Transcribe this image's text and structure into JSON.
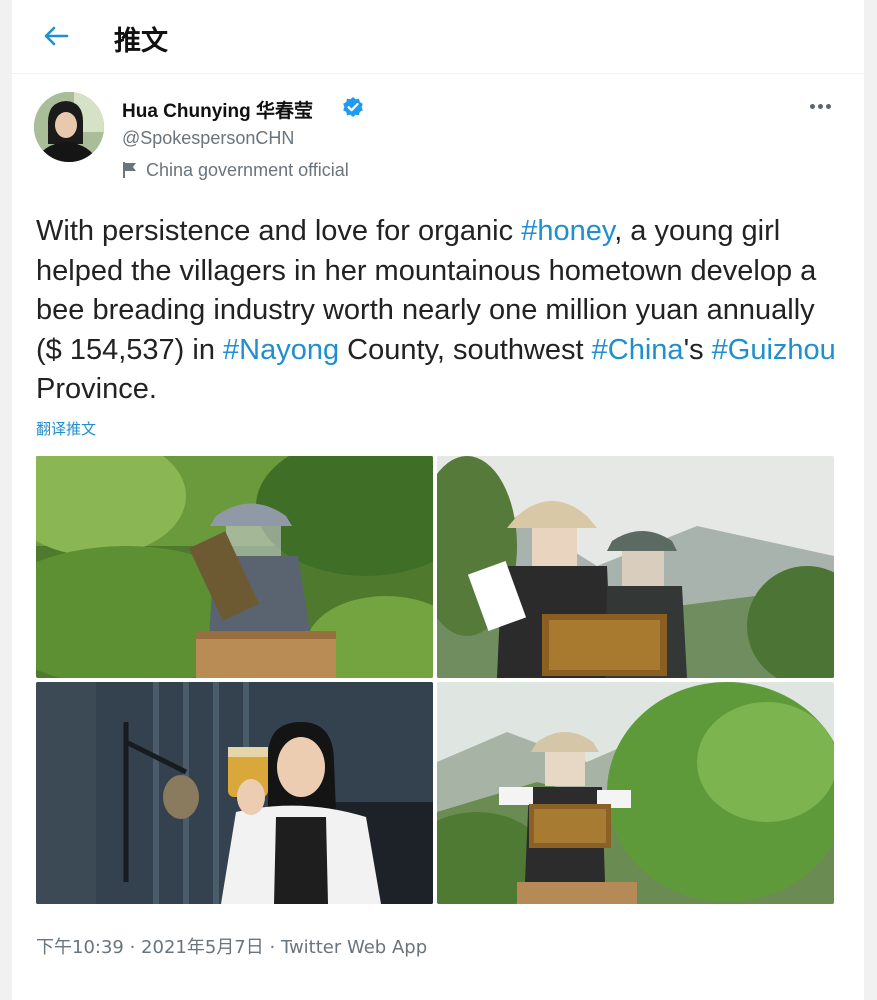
{
  "header": {
    "title": "推文"
  },
  "author": {
    "name": "Hua Chunying 华春莹",
    "handle": "@SpokespersonCHN",
    "label": "China government official"
  },
  "tweet": {
    "segments": [
      {
        "text": "With persistence and love for organic ",
        "tag": false
      },
      {
        "text": "#honey",
        "tag": true
      },
      {
        "text": ", a young girl helped the villagers in her mountainous hometown develop a bee breading industry worth nearly one million yuan annually ($ 154,537) in ",
        "tag": false
      },
      {
        "text": "#Nayong",
        "tag": true
      },
      {
        "text": " County, southwest ",
        "tag": false
      },
      {
        "text": "#China",
        "tag": true
      },
      {
        "text": "'s ",
        "tag": false
      },
      {
        "text": "#Guizhou",
        "tag": true
      },
      {
        "text": " Province.",
        "tag": false
      }
    ],
    "translate_label": "翻译推文",
    "time": "下午10:39",
    "date": "2021年5月7日",
    "source": "Twitter Web App",
    "separator": " · "
  },
  "colors": {
    "link": "#1f8fcf",
    "verified": "#1d9bf0",
    "muted": "#6a747c"
  }
}
